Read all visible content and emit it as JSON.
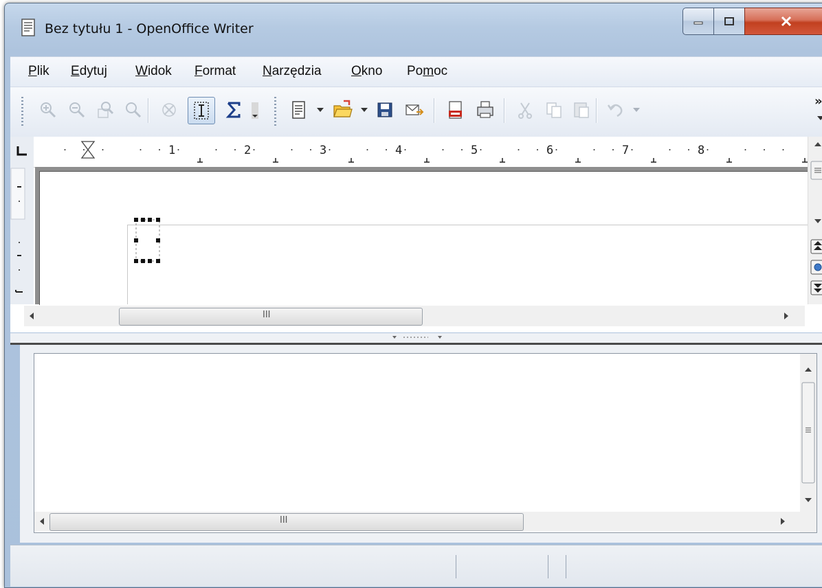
{
  "window": {
    "title": "Bez tytułu 1 - OpenOffice Writer"
  },
  "menubar": {
    "items": [
      {
        "accel": "P",
        "rest": "lik"
      },
      {
        "accel": "E",
        "rest": "dytuj"
      },
      {
        "accel": "W",
        "rest": "idok"
      },
      {
        "accel": "F",
        "rest": "ormat"
      },
      {
        "accel": "N",
        "rest": "arzędzia"
      },
      {
        "accel": "O",
        "rest": "kno"
      },
      {
        "pre": "Po",
        "accel": "m",
        "rest": "oc"
      }
    ]
  },
  "toolbar": {
    "overflow": "»",
    "icons": [
      "zoom-in-icon",
      "zoom-out-icon",
      "zoom-page-icon",
      "zoom-width-icon",
      "refresh-icon",
      "text-cursor-icon",
      "sum-icon",
      "new-document-icon",
      "open-folder-icon",
      "save-icon",
      "email-icon",
      "pdf-export-icon",
      "print-icon",
      "cut-icon",
      "copy-icon",
      "paste-icon",
      "undo-icon"
    ]
  },
  "ruler": {
    "numbers": [
      "1",
      "2",
      "3",
      "4",
      "5",
      "6",
      "7",
      "8"
    ]
  },
  "scrollbar": {
    "thumb_grip": "III"
  },
  "colors": {
    "title_bar": "#b5cae2",
    "close_button": "#c1401f",
    "page_shadow": "#8e8e8e"
  }
}
